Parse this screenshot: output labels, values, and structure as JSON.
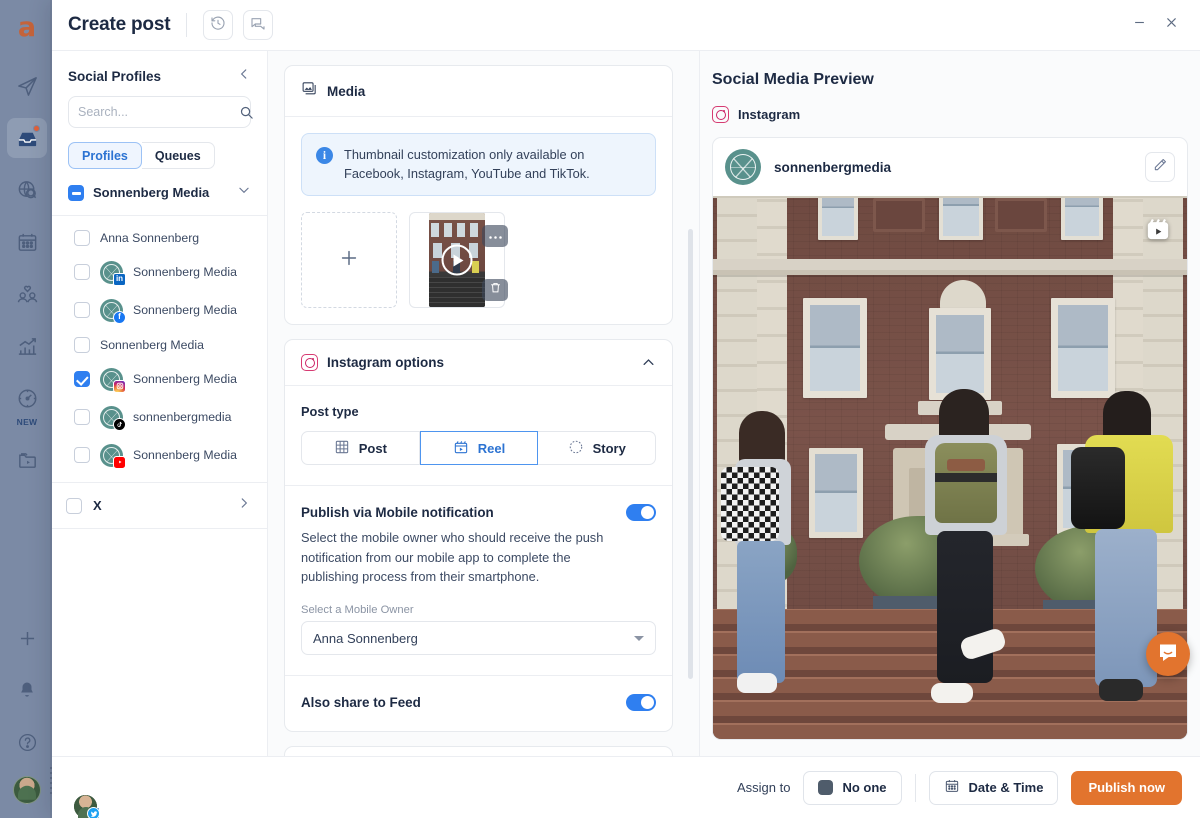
{
  "colors": {
    "accent_blue": "#2f7ff0",
    "accent_orange": "#e2742e",
    "rail_bg": "#7b8aa5",
    "text_dark": "#1d2a43",
    "info_bg": "#eef5fd"
  },
  "app_rail": {
    "logo": "a",
    "items": [
      {
        "name": "publish-icon",
        "label": ""
      },
      {
        "name": "inbox-icon",
        "label": "",
        "active": true,
        "notification": true
      },
      {
        "name": "listening-icon",
        "label": ""
      },
      {
        "name": "calendar-icon",
        "label": ""
      },
      {
        "name": "audience-icon",
        "label": ""
      },
      {
        "name": "analytics-icon",
        "label": ""
      },
      {
        "name": "benchmarks-icon",
        "label": "NEW"
      },
      {
        "name": "media-library-icon",
        "label": ""
      }
    ],
    "bottom_items": [
      {
        "name": "add-icon"
      },
      {
        "name": "bell-icon"
      },
      {
        "name": "help-icon"
      },
      {
        "name": "user-avatar"
      }
    ]
  },
  "header": {
    "title": "Create post",
    "history_icon": "history-icon",
    "comments_icon": "comments-icon",
    "minimize_label": "–",
    "close_label": "✕"
  },
  "sidebar": {
    "title": "Social Profiles",
    "collapse_icon": "chevron-left-icon",
    "search": {
      "value": "",
      "placeholder": "Search..."
    },
    "tabs": [
      {
        "label": "Profiles",
        "active": true
      },
      {
        "label": "Queues",
        "active": false
      }
    ],
    "group": {
      "label": "Sonnenberg Media",
      "checkbox_state": "indeterminate",
      "expanded": true
    },
    "profiles": [
      {
        "label": "Anna Sonnenberg",
        "network": "linkedin",
        "avatar": "person",
        "checked": false
      },
      {
        "label": "Sonnenberg Media",
        "network": "linkedin",
        "avatar": "logo",
        "checked": false
      },
      {
        "label": "Sonnenberg Media",
        "network": "facebook",
        "avatar": "logo",
        "checked": false
      },
      {
        "label": "Sonnenberg Media",
        "network": "twitter",
        "avatar": "person",
        "checked": false
      },
      {
        "label": "Sonnenberg Media",
        "network": "instagram",
        "avatar": "logo",
        "checked": true
      },
      {
        "label": "sonnenbergmedia",
        "network": "tiktok",
        "avatar": "logo",
        "checked": false
      },
      {
        "label": "Sonnenberg Media",
        "network": "youtube",
        "avatar": "logo",
        "checked": false
      }
    ],
    "second_group": {
      "label": "X",
      "checkbox_state": "unchecked",
      "expanded": false,
      "chevron": "chevron-right-icon"
    }
  },
  "composer": {
    "media": {
      "title": "Media",
      "icon": "images-icon",
      "info_banner": "Thumbnail customization only available on Facebook, Instagram, YouTube and TikTok.",
      "add_tile_label": "+",
      "thumbnail": {
        "type": "video",
        "play_icon": "play-icon",
        "more_icon": "ellipsis-icon",
        "delete_icon": "trash-icon"
      }
    },
    "instagram_options": {
      "title": "Instagram options",
      "icon": "instagram-icon",
      "collapse_icon": "chevron-up-icon",
      "post_type": {
        "label": "Post type",
        "options": [
          {
            "label": "Post",
            "icon": "grid-icon",
            "active": false
          },
          {
            "label": "Reel",
            "icon": "reel-icon",
            "active": true
          },
          {
            "label": "Story",
            "icon": "story-icon",
            "active": false
          }
        ]
      },
      "mobile_notification": {
        "title": "Publish via Mobile notification",
        "toggle_on": true,
        "description": "Select the mobile owner who should receive the push notification from our mobile app to complete the publishing process from their smartphone.",
        "field_label": "Select a Mobile Owner",
        "selected_owner": "Anna Sonnenberg"
      },
      "share_to_feed": {
        "title": "Also share to Feed",
        "toggle_on": true
      }
    }
  },
  "preview": {
    "title": "Social Media Preview",
    "network": {
      "label": "Instagram",
      "icon": "instagram-icon"
    },
    "handle": "sonnenbergmedia",
    "edit_icon": "pencil-icon",
    "media_badge": "reel-icon",
    "chat_widget": "intercom-chat-icon"
  },
  "footer": {
    "assign_label": "Assign to",
    "assignee": "No one",
    "assignee_icon": "user-square-icon",
    "schedule": {
      "label": "Date & Time",
      "icon": "calendar-icon"
    },
    "publish": "Publish now"
  }
}
